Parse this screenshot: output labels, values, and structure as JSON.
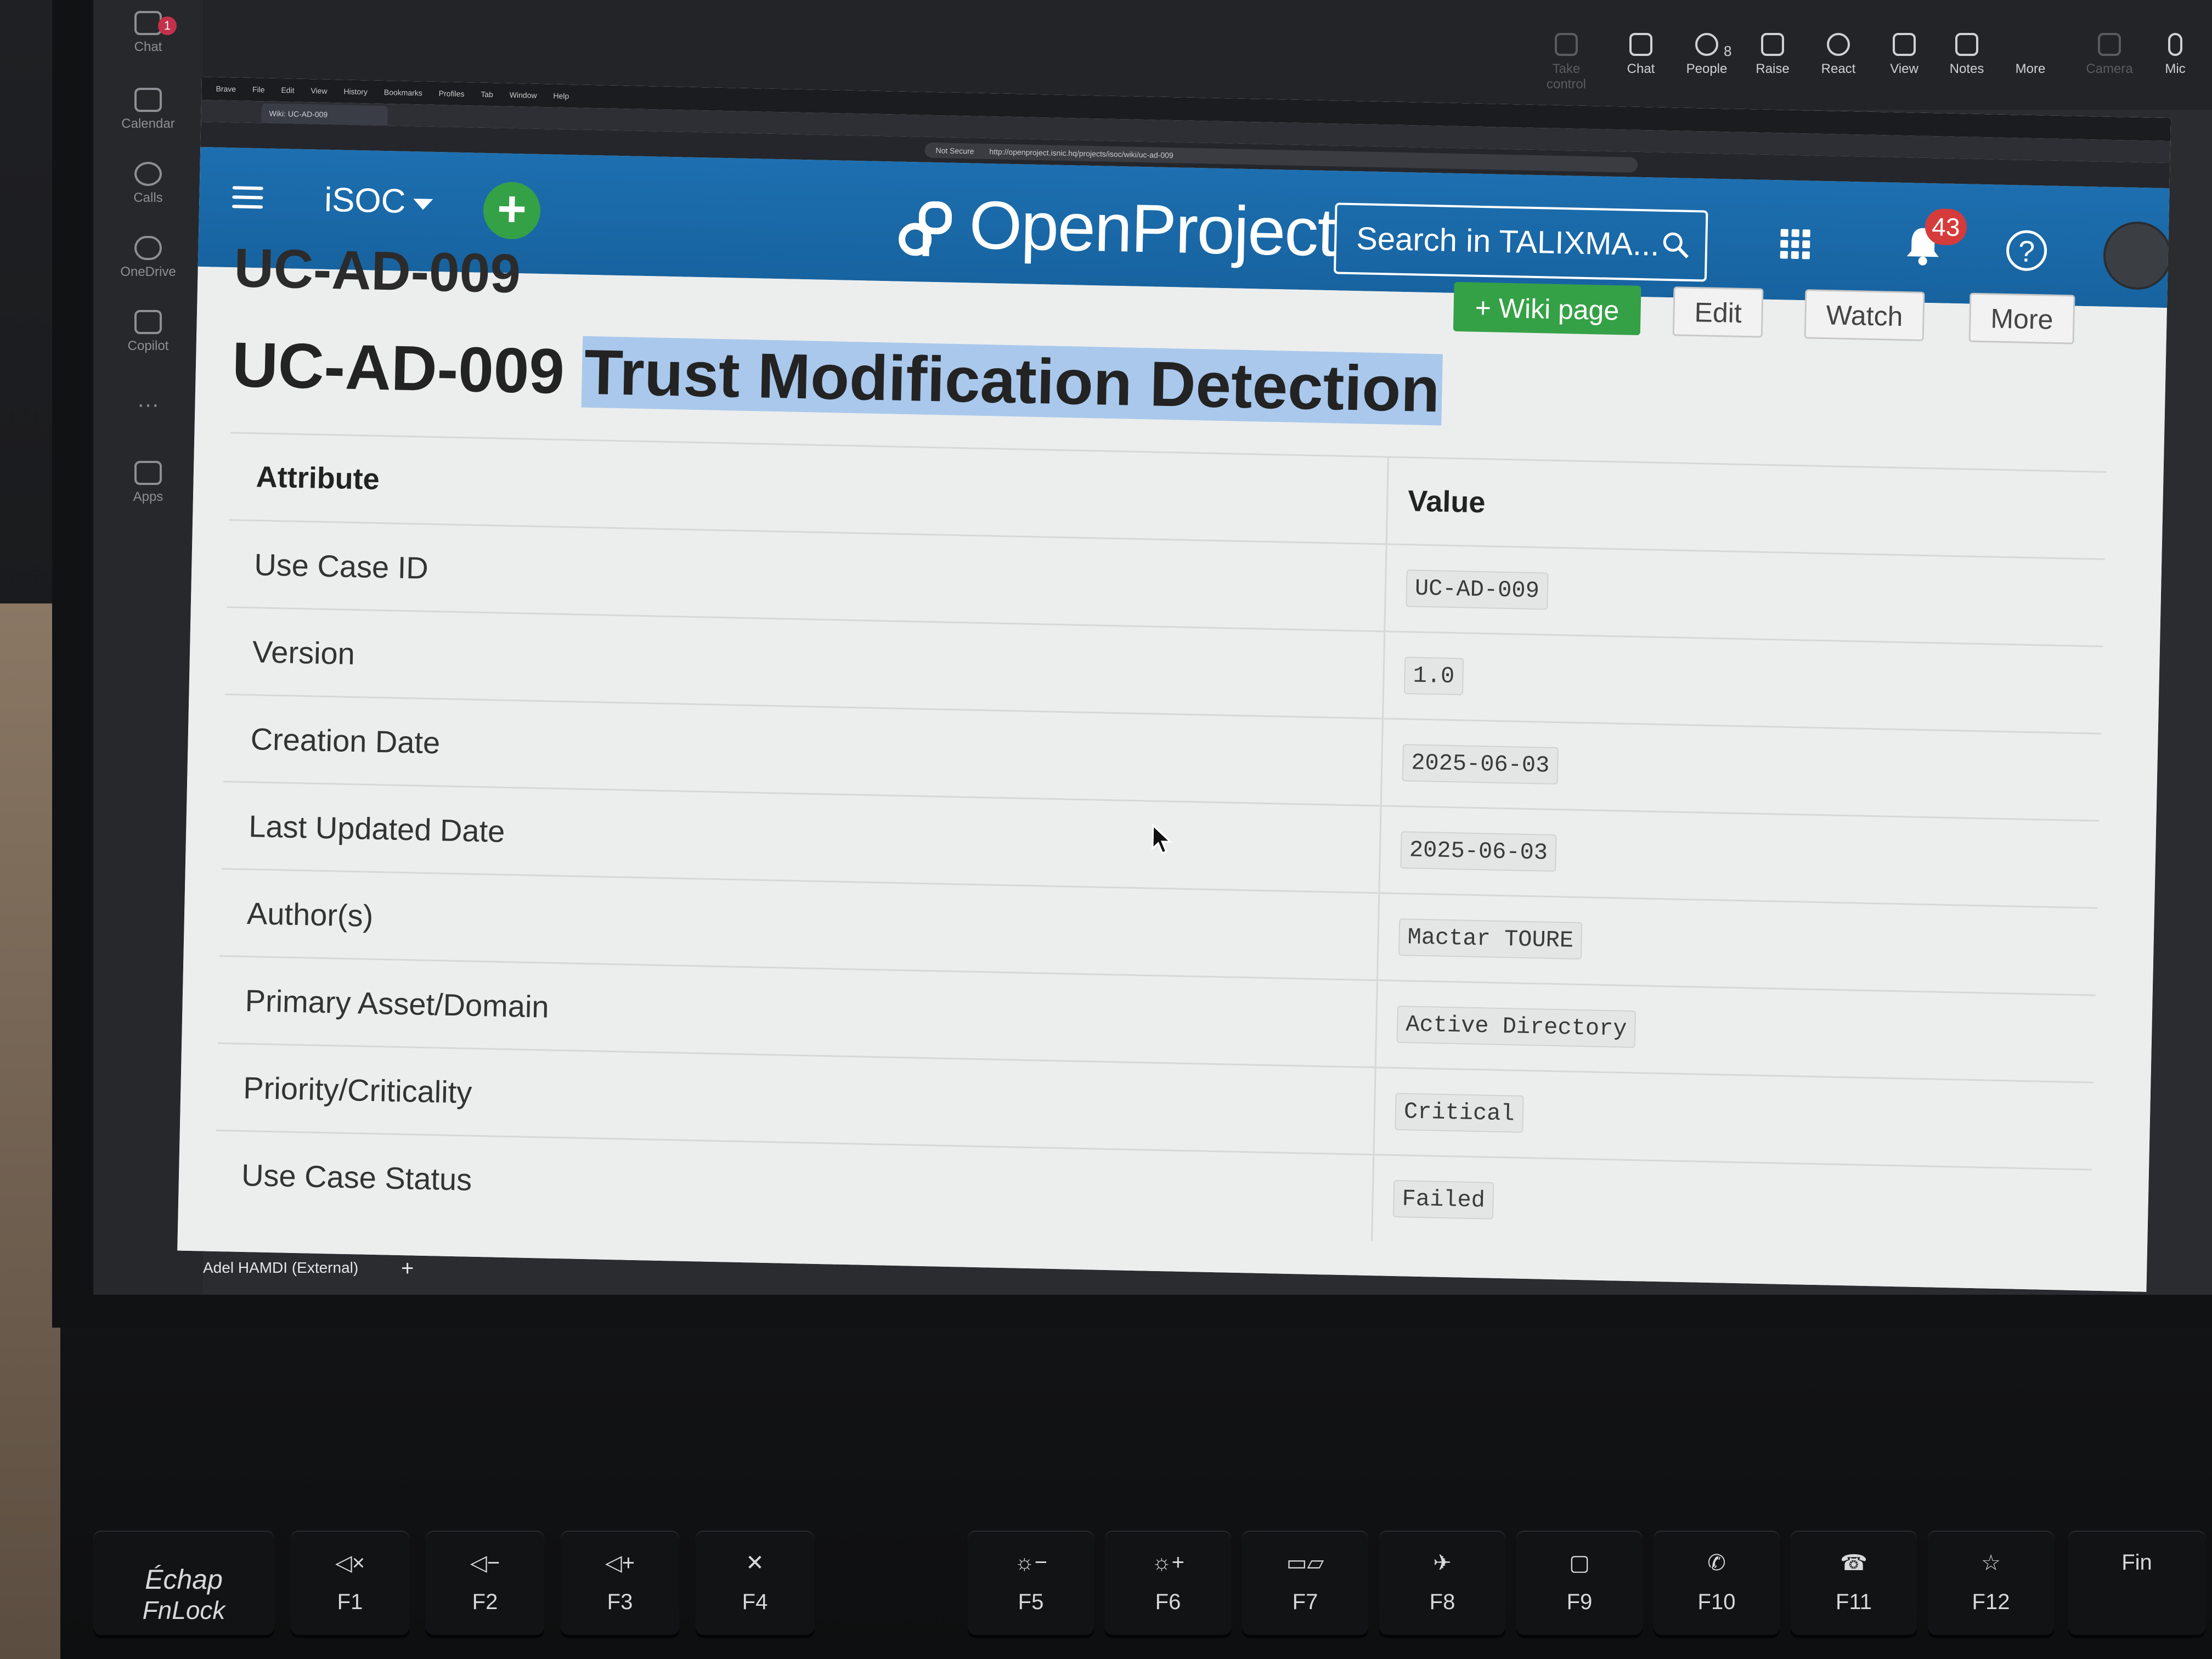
{
  "teams": {
    "rail": [
      {
        "label": "Chat",
        "badge": "1",
        "icon": "chat-icon"
      },
      {
        "label": "Calendar",
        "icon": "calendar-icon"
      },
      {
        "label": "Calls",
        "icon": "phone-icon"
      },
      {
        "label": "OneDrive",
        "icon": "cloud-icon"
      },
      {
        "label": "Copilot",
        "icon": "copilot-icon"
      },
      {
        "label": "···",
        "icon": "more-icon"
      },
      {
        "label": "Apps",
        "icon": "apps-icon"
      }
    ],
    "meeting_bar": [
      {
        "label": "Take control",
        "icon": "take-control-icon",
        "dim": true
      },
      {
        "label": "Chat",
        "icon": "chat-icon"
      },
      {
        "label": "People",
        "icon": "people-icon",
        "count": "8"
      },
      {
        "label": "Raise",
        "icon": "raise-hand-icon"
      },
      {
        "label": "React",
        "icon": "react-icon"
      },
      {
        "label": "View",
        "icon": "view-icon"
      },
      {
        "label": "Notes",
        "icon": "notes-icon"
      },
      {
        "label": "More",
        "icon": "more-icon"
      },
      {
        "label": "Camera",
        "icon": "camera-icon",
        "dim": true
      },
      {
        "label": "Mic",
        "icon": "mic-icon"
      }
    ],
    "footer_user": "Adel HAMDI (External)",
    "footer_add": "+"
  },
  "browser": {
    "menubar": [
      "Brave",
      "File",
      "Edit",
      "View",
      "History",
      "Bookmarks",
      "Profiles",
      "Tab",
      "Window",
      "Help"
    ],
    "tab_title": "Wiki: UC-AD-009",
    "url_security": "Not Secure",
    "url": "http://openproject.isnic.hq/projects/isoc/wiki/uc-ad-009"
  },
  "header": {
    "project": "iSOC",
    "logo_text": "OpenProject",
    "search_placeholder": "Search in TALIXMA...",
    "notifications_count": "43",
    "help": "?"
  },
  "page": {
    "crumb": "UC-AD-009",
    "toolbar": {
      "wiki_page": "+ Wiki page",
      "edit": "Edit",
      "watch": "Watch",
      "more": "More"
    },
    "title_id": "UC-AD-009",
    "title_highlighted": "Trust Modification Detection",
    "table": {
      "header_attribute": "Attribute",
      "header_value": "Value",
      "rows": [
        {
          "key": "Use Case ID",
          "value": "UC-AD-009"
        },
        {
          "key": "Version",
          "value": "1.0"
        },
        {
          "key": "Creation Date",
          "value": "2025-06-03"
        },
        {
          "key": "Last Updated Date",
          "value": "2025-06-03"
        },
        {
          "key": "Author(s)",
          "value": "Mactar TOURE"
        },
        {
          "key": "Primary Asset/Domain",
          "value": "Active Directory"
        },
        {
          "key": "Priority/Criticality",
          "value": "Critical"
        },
        {
          "key": "Use Case Status",
          "value": "Failed"
        }
      ]
    }
  },
  "keyboard": {
    "esc_main": "Échap",
    "esc_sub": "FnLock",
    "fkeys": [
      "F1",
      "F2",
      "F3",
      "F4",
      "F5",
      "F6",
      "F7",
      "F8",
      "F9",
      "F10",
      "F11",
      "F12"
    ],
    "end": "Fin"
  },
  "colors": {
    "op_header": "#1d6fb0",
    "plus_green": "#35a146",
    "badge_red": "#d63b3b",
    "highlight": "#a9c8ec"
  }
}
